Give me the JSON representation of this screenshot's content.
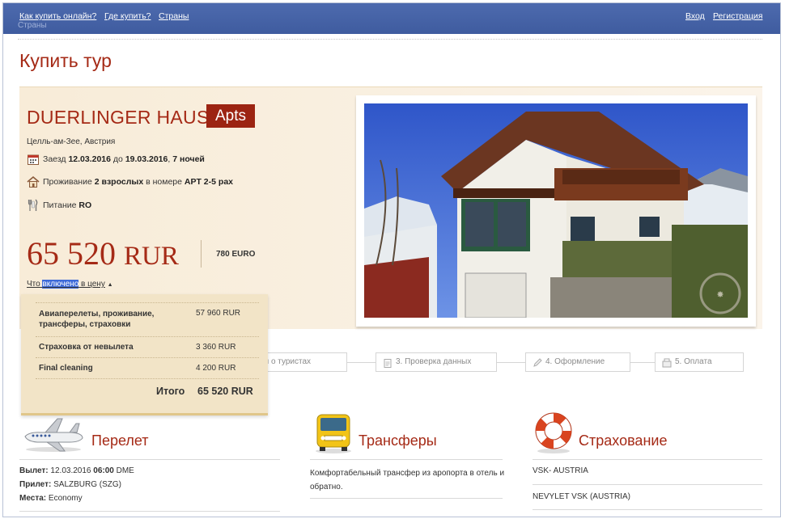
{
  "topbar": {
    "links_left": [
      "Как купить онлайн?",
      "Где купить?",
      "Страны"
    ],
    "links_right": [
      "Вход",
      "Регистрация"
    ],
    "breadcrumb_ghost": "Страны"
  },
  "page": {
    "title": "Купить тур"
  },
  "hotel": {
    "name": "DUERLINGER HAUS",
    "badge": "Apts",
    "location": "Целль-ам-Зее, Австрия"
  },
  "stay": {
    "checkin_prefix": "Заезд",
    "checkin_date": "12.03.2016",
    "to_word": "до",
    "checkout_date": "19.03.2016",
    "nights": "7 ночей",
    "accommodation_prefix": "Проживание",
    "guests": "2 взрослых",
    "room_word": "в номере",
    "room": "APT 2-5 pax",
    "meal_prefix": "Питание",
    "meal": "RO"
  },
  "price": {
    "amount": "65 520",
    "currency": "RUR",
    "euro": "780 EURO",
    "included_link_pre": "Что ",
    "included_link_hl": "включено",
    "included_link_post": " в цену"
  },
  "breakdown": {
    "items": [
      {
        "label": "Авиаперелеты, проживание, трансферы, страховки",
        "value": "57 960 RUR"
      },
      {
        "label": "Страховка от невылета",
        "value": "3 360 RUR"
      },
      {
        "label": "Final cleaning",
        "value": "4 200 RUR"
      }
    ],
    "total_label": "Итого",
    "total_value": "65 520 RUR"
  },
  "steps": [
    {
      "label": "мация о туристах"
    },
    {
      "label": "3. Проверка данных"
    },
    {
      "label": "4. Оформление"
    },
    {
      "label": "5. Оплата"
    }
  ],
  "services": {
    "flight": {
      "title": "Перелет",
      "departure_label": "Вылет:",
      "departure_date": "12.03.2016",
      "departure_time": "06:00",
      "departure_airport": "DME",
      "arrival_label": "Прилет:",
      "arrival_value": "SALZBURG (SZG)",
      "seats_label": "Места:",
      "seats_value": "Economy"
    },
    "transfer": {
      "title": "Трансферы",
      "description": "Комфортабельный трансфер из аропорта в отель и обратно."
    },
    "insurance": {
      "title": "Страхование",
      "items": [
        "VSK- AUSTRIA",
        "NEVYLET VSK (AUSTRIA)"
      ]
    }
  },
  "colors": {
    "accent": "#a52a16",
    "topbar": "#4563a6",
    "hero_bg": "#f8ecd8"
  }
}
